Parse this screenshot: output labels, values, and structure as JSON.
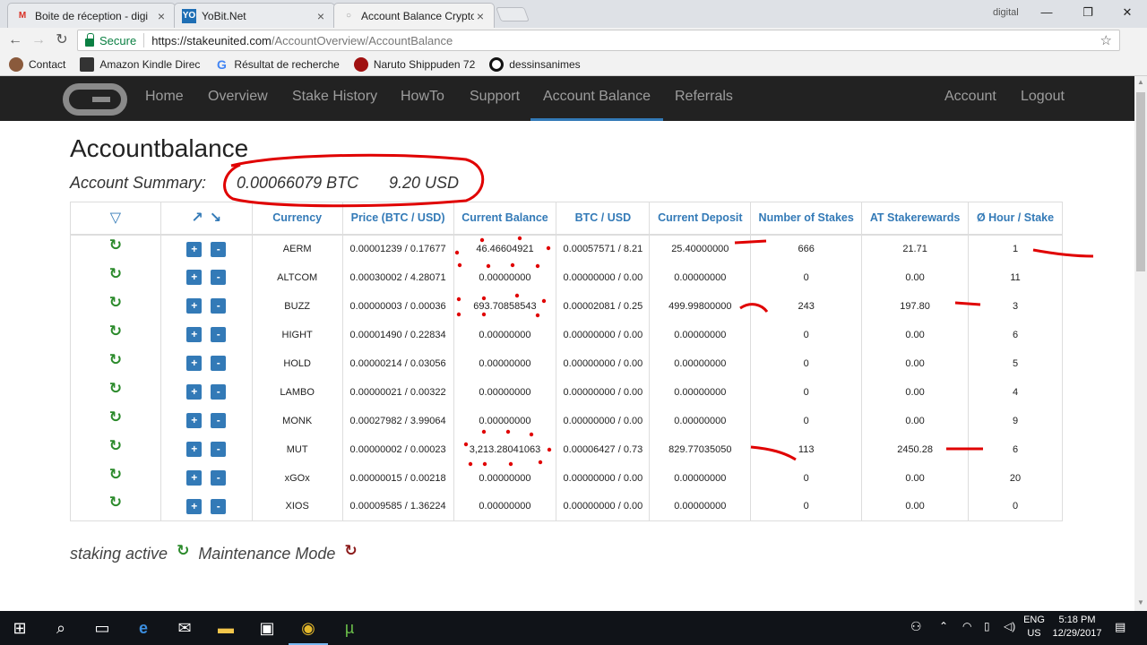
{
  "browser": {
    "tabs": [
      {
        "icon": "gmail-icon",
        "title": "Boite de réception - digi"
      },
      {
        "icon": "yobit-icon",
        "title": "YoBit.Net"
      },
      {
        "icon": "page-icon",
        "title": "Account Balance CryptoU"
      }
    ],
    "window_label": "digital",
    "secure_label": "Secure",
    "url_host": "https://stakeunited.com",
    "url_path": "/AccountOverview/AccountBalance",
    "bookmarks": [
      "Contact",
      "Amazon Kindle Direc",
      "Résultat de recherche",
      "Naruto Shippuden 72",
      "dessinsanimes"
    ]
  },
  "site_nav": {
    "links": [
      "Home",
      "Overview",
      "Stake History",
      "HowTo",
      "Support",
      "Account Balance",
      "Referrals"
    ],
    "active": "Account Balance",
    "right_links": [
      "Account",
      "Logout"
    ]
  },
  "page": {
    "title": "Accountbalance",
    "summary_label": "Account Summary:",
    "summary_btc": "0.00066079 BTC",
    "summary_usd": "9.20 USD",
    "legend_active": "staking active",
    "legend_maintenance": "Maintenance Mode"
  },
  "table": {
    "headers": [
      "Currency",
      "Price (BTC / USD)",
      "Current Balance",
      "BTC / USD",
      "Current Deposit",
      "Number of Stakes",
      "AT Stakerewards",
      "Ø Hour / Stake"
    ],
    "plus_label": "+",
    "minus_label": "-",
    "rows": [
      [
        "AERM",
        "0.00001239 / 0.17677",
        "46.46604921",
        "0.00057571 / 8.21",
        "25.40000000",
        "666",
        "21.71",
        "1"
      ],
      [
        "ALTCOM",
        "0.00030002 / 4.28071",
        "0.00000000",
        "0.00000000 / 0.00",
        "0.00000000",
        "0",
        "0.00",
        "11"
      ],
      [
        "BUZZ",
        "0.00000003 / 0.00036",
        "693.70858543",
        "0.00002081 / 0.25",
        "499.99800000",
        "243",
        "197.80",
        "3"
      ],
      [
        "HIGHT",
        "0.00001490 / 0.22834",
        "0.00000000",
        "0.00000000 / 0.00",
        "0.00000000",
        "0",
        "0.00",
        "6"
      ],
      [
        "HOLD",
        "0.00000214 / 0.03056",
        "0.00000000",
        "0.00000000 / 0.00",
        "0.00000000",
        "0",
        "0.00",
        "5"
      ],
      [
        "LAMBO",
        "0.00000021 / 0.00322",
        "0.00000000",
        "0.00000000 / 0.00",
        "0.00000000",
        "0",
        "0.00",
        "4"
      ],
      [
        "MONK",
        "0.00027982 / 3.99064",
        "0.00000000",
        "0.00000000 / 0.00",
        "0.00000000",
        "0",
        "0.00",
        "9"
      ],
      [
        "MUT",
        "0.00000002 / 0.00023",
        "3,213.28041063",
        "0.00006427 / 0.73",
        "829.77035050",
        "113",
        "2450.28",
        "6"
      ],
      [
        "xGOx",
        "0.00000015 / 0.00218",
        "0.00000000",
        "0.00000000 / 0.00",
        "0.00000000",
        "0",
        "0.00",
        "20"
      ],
      [
        "XIOS",
        "0.00009585 / 1.36224",
        "0.00000000",
        "0.00000000 / 0.00",
        "0.00000000",
        "0",
        "0.00",
        "0"
      ]
    ]
  },
  "taskbar": {
    "lang": "ENG",
    "region": "US",
    "time": "5:18 PM",
    "date": "12/29/2017"
  },
  "colors": {
    "navbar": "#222222",
    "link_blue": "#337ab7",
    "active_green": "#2b8a2b",
    "maintenance_red": "#8b1a1a",
    "annotation_red": "#e00000"
  }
}
